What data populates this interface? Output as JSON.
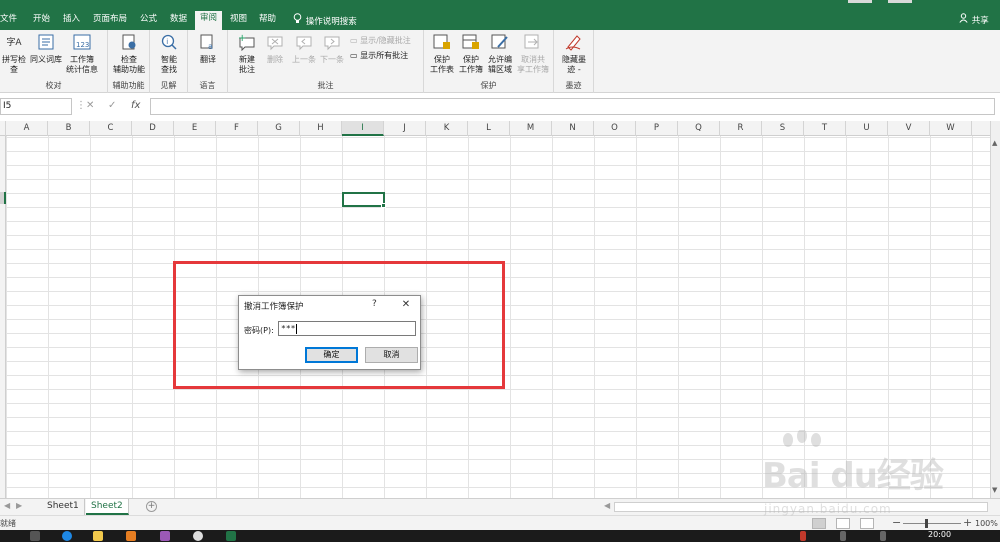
{
  "ribbon_tabs": [
    {
      "label": "文件"
    },
    {
      "label": "开始"
    },
    {
      "label": "插入"
    },
    {
      "label": "页面布局"
    },
    {
      "label": "公式"
    },
    {
      "label": "数据"
    },
    {
      "label": "审阅",
      "active": true
    },
    {
      "label": "视图"
    },
    {
      "label": "帮助"
    },
    {
      "label": "操作说明搜索",
      "icon": "lightbulb-icon"
    }
  ],
  "share": {
    "label": "共享",
    "icon": "person-icon"
  },
  "ribbon": {
    "proofing": {
      "label": "校对",
      "spell": "拼写检查",
      "thesaurus": "同义词库",
      "stats_line1": "工作簿",
      "stats_line2": "统计信息"
    },
    "accessibility": {
      "label": "辅助功能",
      "btn_line1": "检查",
      "btn_line2": "辅助功能"
    },
    "insights": {
      "label": "见解",
      "btn_line1": "智能",
      "btn_line2": "查找"
    },
    "language": {
      "label": "语言",
      "btn": "翻译"
    },
    "comments": {
      "label": "批注",
      "new_line1": "新建",
      "new_line2": "批注",
      "delete": "删除",
      "prev": "上一条",
      "next": "下一条",
      "toggle": "显示/隐藏批注",
      "show_all": "显示所有批注"
    },
    "protect": {
      "label": "保护",
      "sheet_line1": "保护",
      "sheet_line2": "工作表",
      "book_line1": "保护",
      "book_line2": "工作簿",
      "edit_line1": "允许编",
      "edit_line2": "辑区域",
      "unshare_line1": "取消共",
      "unshare_line2": "享工作簿"
    },
    "ink": {
      "label": "墨迹",
      "btn_line1": "隐藏墨",
      "btn_line2": "迹 -"
    }
  },
  "formula_bar": {
    "name_box": "I5",
    "cancel_icon": "✕",
    "enter_icon": "✓",
    "fx": "fx"
  },
  "columns": [
    "A",
    "B",
    "C",
    "D",
    "E",
    "F",
    "G",
    "H",
    "I",
    "J",
    "K",
    "L",
    "M",
    "N",
    "O",
    "P",
    "Q",
    "R",
    "S",
    "T",
    "U",
    "V",
    "W"
  ],
  "selected_column": "I",
  "dialog": {
    "title": "撤消工作簿保护",
    "help": "?",
    "password_label": "密码(P):",
    "password_value": "***",
    "ok": "确定",
    "cancel": "取消"
  },
  "sheets": [
    {
      "name": "Sheet1"
    },
    {
      "name": "Sheet2",
      "active": true
    }
  ],
  "add_sheet": "+",
  "status": {
    "ready": "就绪",
    "zoom": "100%"
  },
  "clock": "20:00",
  "watermark": {
    "brand": "Bai du经验",
    "url": "jingyan.baidu.com"
  },
  "colors": {
    "excel_green": "#217346",
    "highlight_red": "#e5383b",
    "focus_blue": "#0078d7"
  }
}
